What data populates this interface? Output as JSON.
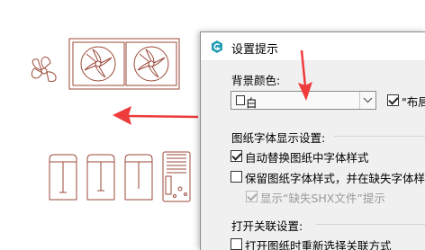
{
  "dialog": {
    "title": "设置提示",
    "bg_color_label": "背景颜色:",
    "bg_color_value": "白",
    "layout_checkbox_label": "\"布局",
    "drawing_font_header": "图纸字体显示设置:",
    "opt_auto_replace": "自动替换图纸中字体样式",
    "opt_keep_font": "保留图纸字体样式，并在缺失字体样式",
    "opt_show_missing_shx": "显示“缺失SHX文件”提示",
    "open_assoc_header": "打开关联设置:",
    "opt_reselect_assoc": "打开图纸时重新选择关联方式"
  },
  "state": {
    "layout_checked": true,
    "auto_replace_checked": true,
    "keep_font_checked": false,
    "show_missing_shx_checked": true,
    "show_missing_shx_disabled": true,
    "reselect_assoc_checked": false
  },
  "colors": {
    "drawing_stroke": "#9b4a3a",
    "annotation_arrow": "#ee3b3b",
    "app_icon": "#1f9bb5"
  },
  "icons": [
    "fan-icon",
    "exhaust-fan-icon",
    "appliance-icon",
    "arrow-icon",
    "app-logo-icon",
    "dropdown-arrow-icon",
    "checkbox-check-icon"
  ]
}
